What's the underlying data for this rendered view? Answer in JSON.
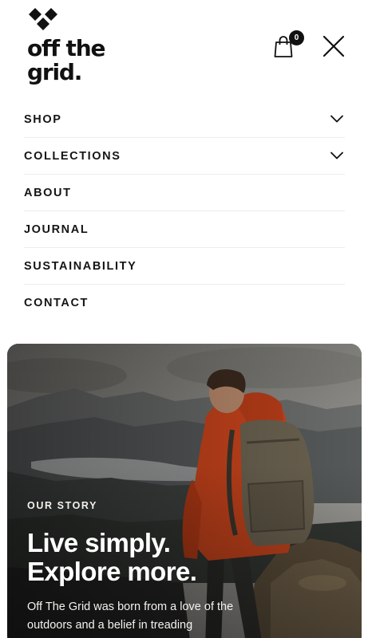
{
  "brand": {
    "logo_line1": "off the",
    "logo_line2": "grid."
  },
  "header": {
    "cart_count": "0",
    "cart_icon": "shopping-bag-icon",
    "close_icon": "close-icon"
  },
  "menu": {
    "items": [
      {
        "label": "SHOP",
        "has_submenu": true
      },
      {
        "label": "COLLECTIONS",
        "has_submenu": true
      },
      {
        "label": "ABOUT",
        "has_submenu": false
      },
      {
        "label": "JOURNAL",
        "has_submenu": false
      },
      {
        "label": "SUSTAINABILITY",
        "has_submenu": false
      },
      {
        "label": "CONTACT",
        "has_submenu": false
      }
    ]
  },
  "hero": {
    "eyebrow": "OUR STORY",
    "title_line1": "Live simply.",
    "title_line2": "Explore more.",
    "body": "Off The Grid was born from a love of the outdoors and a belief in treading"
  },
  "colors": {
    "text": "#111111",
    "divider": "#ececec",
    "jacket": "#c9441c",
    "backpack": "#6b6250"
  }
}
